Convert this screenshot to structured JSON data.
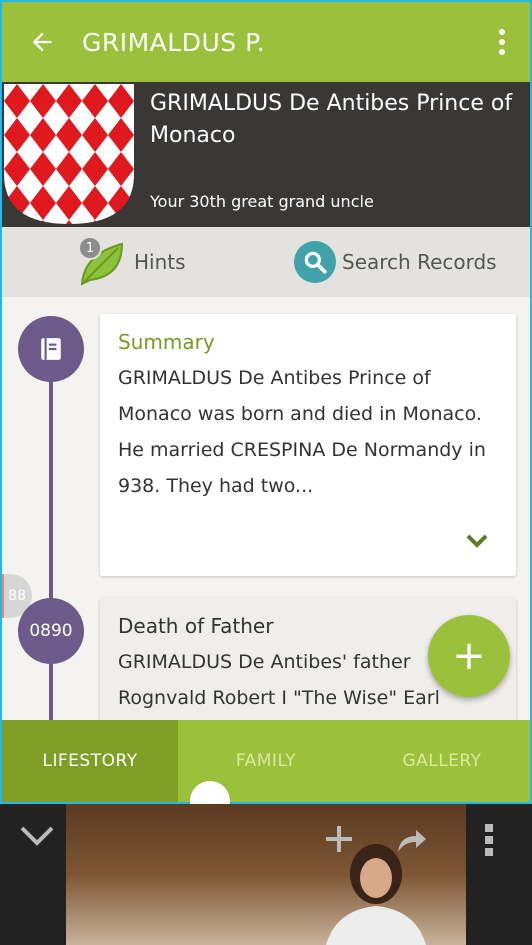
{
  "appbar": {
    "title": "GRIMALDUS P."
  },
  "profile": {
    "name": "GRIMALDUS De Antibes Prince of Monaco",
    "relation": "Your 30th great grand uncle"
  },
  "actions": {
    "hints_count": "1",
    "hints_label": "Hints",
    "search_label": "Search Records"
  },
  "timeline": {
    "side_count": "88",
    "summary": {
      "heading": "Summary",
      "text": "GRIMALDUS De Antibes Prince of Monaco was born and died in Monaco. He married CRESPINA De Normandy in 938. They had two..."
    },
    "event": {
      "year": "0890",
      "heading": "Death of Father",
      "text": "GRIMALDUS De Antibes' father Rognvald Robert I \"The Wise\" Earl"
    }
  },
  "fab": {
    "label": "+"
  },
  "tabs": [
    {
      "label": "LIFESTORY",
      "active": true
    },
    {
      "label": "FAMILY",
      "active": false
    },
    {
      "label": "GALLERY",
      "active": false
    }
  ],
  "colors": {
    "accent": "#9bc03b",
    "timeline": "#6b5a8a",
    "search": "#3fa3a8"
  }
}
